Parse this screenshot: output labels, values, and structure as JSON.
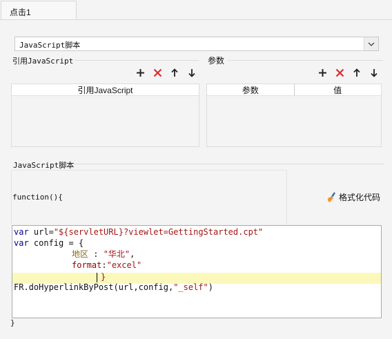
{
  "tab": {
    "title": "点击1"
  },
  "select": {
    "value": "JavaScript脚本"
  },
  "refs": {
    "label": "引用JavaScript",
    "column": "引用JavaScript"
  },
  "params": {
    "label": "参数",
    "col1": "参数",
    "col2": "值"
  },
  "script": {
    "label": "JavaScript脚本",
    "func_header": "function(){",
    "format_button": "格式化代码",
    "closing_brace": "}",
    "code": {
      "l1_kw": "var",
      "l1_name": " url=",
      "l1_str": "\"${servletURL}?viewlet=GettingStarted.cpt\"",
      "l2_kw": "var",
      "l2_name": " config = {",
      "l3_key": "地区",
      "l3_sep": " : ",
      "l3_val": "\"华北\"",
      "l3_end": ",",
      "l4_key": "format",
      "l4_sep": ":",
      "l4_val": "\"excel\"",
      "l5": "}",
      "l6_fn": "FR.doHyperlinkByPost(url,config,",
      "l6_str": "\"_self\"",
      "l6_end": ")"
    }
  }
}
